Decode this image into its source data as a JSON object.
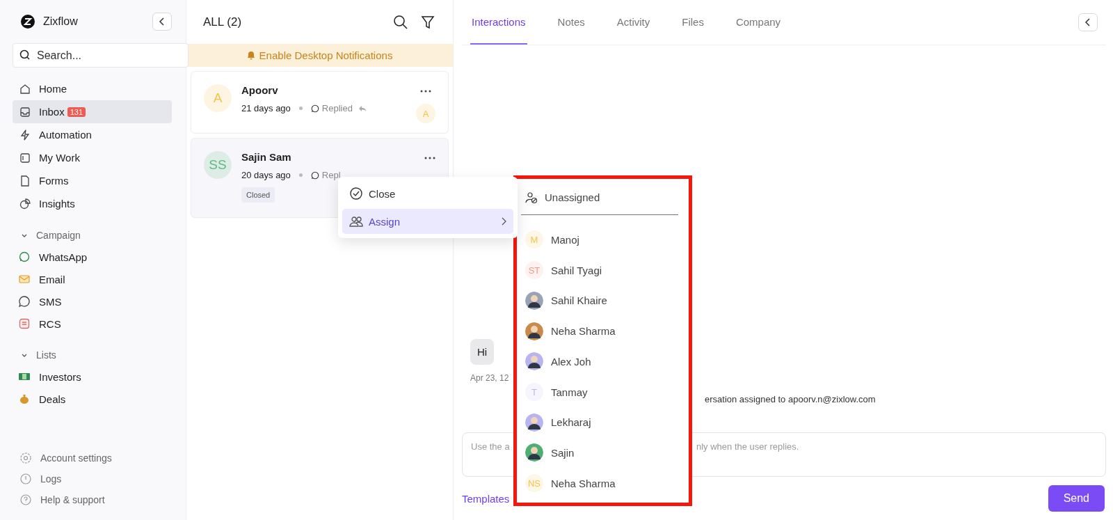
{
  "sidebar": {
    "brand": "Zixflow",
    "search": {
      "placeholder": "Search..."
    },
    "nav": [
      {
        "label": "Home",
        "selected": false
      },
      {
        "label": "Inbox",
        "selected": true,
        "badge": "131"
      },
      {
        "label": "Automation",
        "selected": false
      },
      {
        "label": "My Work",
        "selected": false
      },
      {
        "label": "Forms",
        "selected": false
      },
      {
        "label": "Insights",
        "selected": false
      }
    ],
    "sections": [
      {
        "title": "Campaign",
        "expanded": true,
        "items": [
          {
            "label": "WhatsApp"
          },
          {
            "label": "Email"
          },
          {
            "label": "SMS"
          },
          {
            "label": "RCS"
          }
        ]
      },
      {
        "title": "Lists",
        "expanded": true,
        "items": [
          {
            "label": "Investors"
          },
          {
            "label": "Deals"
          }
        ]
      }
    ],
    "footer": [
      {
        "label": "Account settings"
      },
      {
        "label": "Logs"
      },
      {
        "label": "Help & support"
      }
    ]
  },
  "conversations": {
    "title": "ALL (2)",
    "banner": "Enable Desktop Notifications",
    "items": [
      {
        "name": "Apoorv",
        "initials": "A",
        "color": "#f5c24a",
        "time": "21 days ago",
        "status": "Replied",
        "selected": false,
        "assignee": "A"
      },
      {
        "name": "Sajin Sam",
        "initials": "SS",
        "color": "#5dbb7e",
        "time": "20 days ago",
        "status": "Repl",
        "selected": true,
        "tag": "Closed"
      }
    ]
  },
  "context_menu": {
    "items": [
      {
        "label": "Close",
        "selected": false,
        "submenu": false
      },
      {
        "label": "Assign",
        "selected": true,
        "submenu": true
      }
    ]
  },
  "assign_menu": {
    "unassigned": "Unassigned",
    "agents": [
      {
        "name": "Manoj",
        "kind": "initials",
        "initials": "M",
        "color": "#f5c24a"
      },
      {
        "name": "Sahil Tyagi",
        "kind": "initials",
        "initials": "ST",
        "color": "#ee9a88"
      },
      {
        "name": "Sahil Khaire",
        "kind": "photo",
        "color": "#9aa3b5"
      },
      {
        "name": "Neha Sharma",
        "kind": "photo",
        "color": "#c98a4b"
      },
      {
        "name": "Alex Joh",
        "kind": "photo",
        "color": "#b7b4f0"
      },
      {
        "name": "Tanmay",
        "kind": "initials",
        "initials": "T",
        "color": "#b9b6f4"
      },
      {
        "name": "Lekharaj",
        "kind": "photo",
        "color": "#b7b4f0"
      },
      {
        "name": "Sajin",
        "kind": "photo",
        "color": "#4fae72"
      },
      {
        "name": "Neha Sharma",
        "kind": "initials",
        "initials": "NS",
        "color": "#f5c24a"
      }
    ]
  },
  "detail": {
    "tabs": [
      {
        "label": "Interactions",
        "selected": true
      },
      {
        "label": "Notes",
        "selected": false
      },
      {
        "label": "Activity",
        "selected": false
      },
      {
        "label": "Files",
        "selected": false
      },
      {
        "label": "Company",
        "selected": false
      }
    ],
    "message": {
      "text": "Hi",
      "time": "Apr 23, 12"
    },
    "system_note": "ersation assigned to apoorv.n@zixlow.com",
    "composer": {
      "placeholder_start": "Use the a",
      "placeholder_end": "nly when the user replies."
    },
    "templates_link": "Templates",
    "send_button": "Send"
  }
}
